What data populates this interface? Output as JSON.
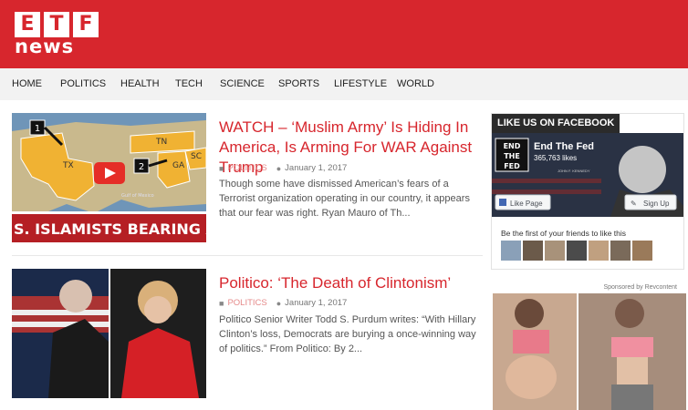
{
  "logo": {
    "letters": [
      "E",
      "T",
      "F"
    ],
    "word": "news"
  },
  "nav": {
    "items": [
      {
        "label": "HOME"
      },
      {
        "label": "POLITICS"
      },
      {
        "label": "HEALTH"
      },
      {
        "label": "TECH"
      },
      {
        "label": "SCIENCE"
      },
      {
        "label": "SPORTS"
      },
      {
        "label": "LIFESTYLE"
      },
      {
        "label": "WORLD"
      }
    ]
  },
  "articles": [
    {
      "title": "WATCH – ‘Muslim Army’ Is Hiding In America, Is Arming For WAR Against Trump",
      "category": "POLITICS",
      "date": "January 1, 2017",
      "excerpt": "Though some have dismissed American’s fears of a Terrorist organization operating in our country, it appears that our fear was right. Ryan Mauro of Th...",
      "thumb": {
        "banner": "S. ISLAMISTS BEARING AR",
        "map_labels": [
          "TX",
          "TN",
          "GA",
          "SC",
          "1",
          "2",
          "Gulf of Mexico"
        ]
      }
    },
    {
      "title": "Politico: ‘The Death of Clintonism’",
      "category": "POLITICS",
      "date": "January 1, 2017",
      "excerpt": "Politico Senior Writer Todd S. Purdum writes: “With Hillary Clinton’s loss, Democrats are burying a once-winning way of politics.” From Politico: By 2..."
    }
  ],
  "sidebar": {
    "fb_heading": "LIKE US ON FACEBOOK",
    "page_name": "End The Fed",
    "likes": "365,763 likes",
    "logo_lines": [
      "END",
      "THE",
      "FED"
    ],
    "caption": "JOHN F. KENNEDY",
    "like_button": "Like Page",
    "signup_button": "Sign Up",
    "friends_text": "Be the first of your friends to like this",
    "sponsored": "Sponsored by Revcontent"
  },
  "colors": {
    "brand": "#d7262d",
    "nav_bg": "#f2f2f2",
    "fb_blue": "#4267b2"
  }
}
